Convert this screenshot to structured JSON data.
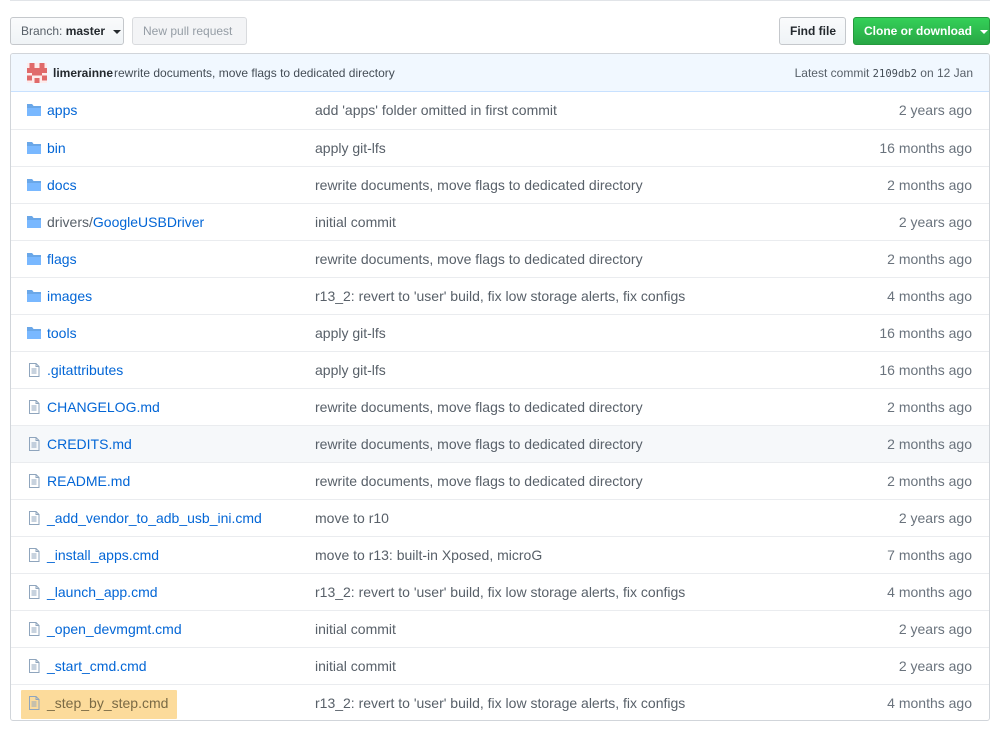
{
  "toolbar": {
    "branch_prefix": "Branch:",
    "branch_name": "master",
    "new_pull_request": "New pull request",
    "find_file": "Find file",
    "clone_or_download": "Clone or download"
  },
  "latest_commit": {
    "author": "limerainne",
    "message": "rewrite documents, move flags to dedicated directory",
    "label": "Latest commit",
    "sha": "2109db2",
    "date": "on 12 Jan"
  },
  "files": [
    {
      "type": "dir",
      "name": "apps",
      "message": "add 'apps' folder omitted in first commit",
      "age": "2 years ago"
    },
    {
      "type": "dir",
      "name": "bin",
      "message": "apply git-lfs",
      "age": "16 months ago"
    },
    {
      "type": "dir",
      "name": "docs",
      "message": "rewrite documents, move flags to dedicated directory",
      "age": "2 months ago"
    },
    {
      "type": "dir",
      "prefix": "drivers/",
      "name": "GoogleUSBDriver",
      "message": "initial commit",
      "age": "2 years ago"
    },
    {
      "type": "dir",
      "name": "flags",
      "message": "rewrite documents, move flags to dedicated directory",
      "age": "2 months ago"
    },
    {
      "type": "dir",
      "name": "images",
      "message": "r13_2: revert to 'user' build, fix low storage alerts, fix configs",
      "age": "4 months ago"
    },
    {
      "type": "dir",
      "name": "tools",
      "message": "apply git-lfs",
      "age": "16 months ago"
    },
    {
      "type": "file",
      "name": ".gitattributes",
      "message": "apply git-lfs",
      "age": "16 months ago"
    },
    {
      "type": "file",
      "name": "CHANGELOG.md",
      "message": "rewrite documents, move flags to dedicated directory",
      "age": "2 months ago"
    },
    {
      "type": "file",
      "name": "CREDITS.md",
      "message": "rewrite documents, move flags to dedicated directory",
      "age": "2 months ago"
    },
    {
      "type": "file",
      "name": "README.md",
      "message": "rewrite documents, move flags to dedicated directory",
      "age": "2 months ago"
    },
    {
      "type": "file",
      "name": "_add_vendor_to_adb_usb_ini.cmd",
      "message": "move to r10",
      "age": "2 years ago"
    },
    {
      "type": "file",
      "name": "_install_apps.cmd",
      "message": "move to r13: built-in Xposed, microG",
      "age": "7 months ago"
    },
    {
      "type": "file",
      "name": "_launch_app.cmd",
      "message": "r13_2: revert to 'user' build, fix low storage alerts, fix configs",
      "age": "4 months ago"
    },
    {
      "type": "file",
      "name": "_open_devmgmt.cmd",
      "message": "initial commit",
      "age": "2 years ago"
    },
    {
      "type": "file",
      "name": "_start_cmd.cmd",
      "message": "initial commit",
      "age": "2 years ago"
    },
    {
      "type": "file",
      "name": "_step_by_step.cmd",
      "message": "r13_2: revert to 'user' build, fix low storage alerts, fix configs",
      "age": "4 months ago"
    }
  ],
  "colors": {
    "link": "#0366d6",
    "folder_icon": "#79b8ff",
    "commit_bar_bg": "#f1f8ff",
    "green_button": "#28a745",
    "highlight": "#fbd58a"
  },
  "icons": {
    "dir": "folder-icon",
    "file": "file-icon"
  }
}
